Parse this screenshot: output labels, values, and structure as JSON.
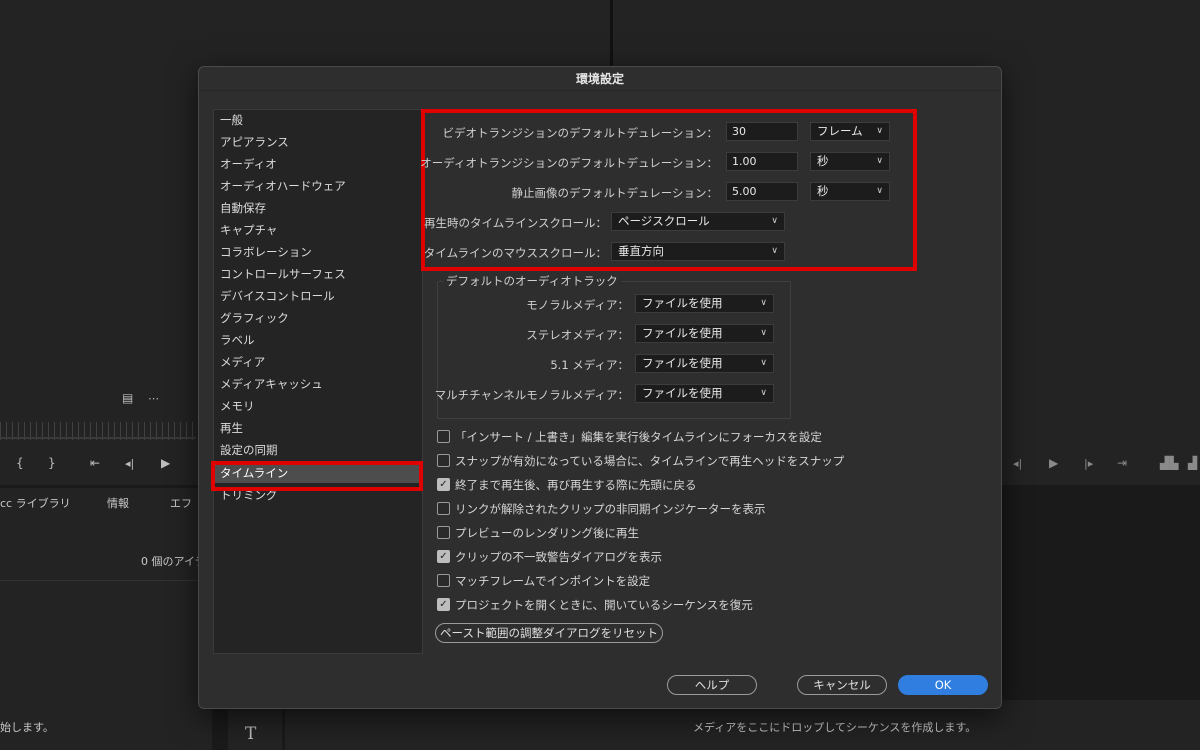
{
  "background": {
    "left_tabs": [
      "cc ライブラリ",
      "情報",
      "エフ"
    ],
    "item_count": "0 個のアイテ",
    "bottom_left_text": "始します。",
    "drop_hint": "メディアをここにドロップしてシーケンスを作成します。"
  },
  "dialog": {
    "title": "環境設定",
    "categories": [
      "一般",
      "アピアランス",
      "オーディオ",
      "オーディオハードウェア",
      "自動保存",
      "キャプチャ",
      "コラボレーション",
      "コントロールサーフェス",
      "デバイスコントロール",
      "グラフィック",
      "ラベル",
      "メディア",
      "メディアキャッシュ",
      "メモリ",
      "再生",
      "設定の同期",
      "タイムライン",
      "トリミング"
    ],
    "selected_category": "タイムライン",
    "video_transition": {
      "label": "ビデオトランジションのデフォルトデュレーション：",
      "value": "30",
      "unit": "フレーム"
    },
    "audio_transition": {
      "label": "オーディオトランジションのデフォルトデュレーション：",
      "value": "1.00",
      "unit": "秒"
    },
    "still_image": {
      "label": "静止画像のデフォルトデュレーション：",
      "value": "5.00",
      "unit": "秒"
    },
    "playback_scroll": {
      "label": "再生時のタイムラインスクロール：",
      "value": "ページスクロール"
    },
    "mouse_scroll": {
      "label": "タイムラインのマウススクロール：",
      "value": "垂直方向"
    },
    "audio_tracks": {
      "legend": "デフォルトのオーディオトラック",
      "mono": {
        "label": "モノラルメディア：",
        "value": "ファイルを使用"
      },
      "stereo": {
        "label": "ステレオメディア：",
        "value": "ファイルを使用"
      },
      "surround": {
        "label": "5.1 メディア：",
        "value": "ファイルを使用"
      },
      "multichannel": {
        "label": "マルチチャンネルモノラルメディア：",
        "value": "ファイルを使用"
      }
    },
    "checkboxes": [
      {
        "label": "「インサート / 上書き」編集を実行後タイムラインにフォーカスを設定",
        "checked": false
      },
      {
        "label": "スナップが有効になっている場合に、タイムラインで再生ヘッドをスナップ",
        "checked": false
      },
      {
        "label": "終了まで再生後、再び再生する際に先頭に戻る",
        "checked": true
      },
      {
        "label": "リンクが解除されたクリップの非同期インジケーターを表示",
        "checked": false
      },
      {
        "label": "プレビューのレンダリング後に再生",
        "checked": false
      },
      {
        "label": "クリップの不一致警告ダイアログを表示",
        "checked": true
      },
      {
        "label": "マッチフレームでインポイントを設定",
        "checked": false
      },
      {
        "label": "プロジェクトを開くときに、開いているシーケンスを復元",
        "checked": true
      }
    ],
    "reset_button": "ペースト範囲の調整ダイアログをリセット",
    "help_button": "ヘルプ",
    "cancel_button": "キャンセル",
    "ok_button": "OK"
  },
  "colors": {
    "highlight": "#e00000",
    "primary": "#2f7ee0"
  }
}
